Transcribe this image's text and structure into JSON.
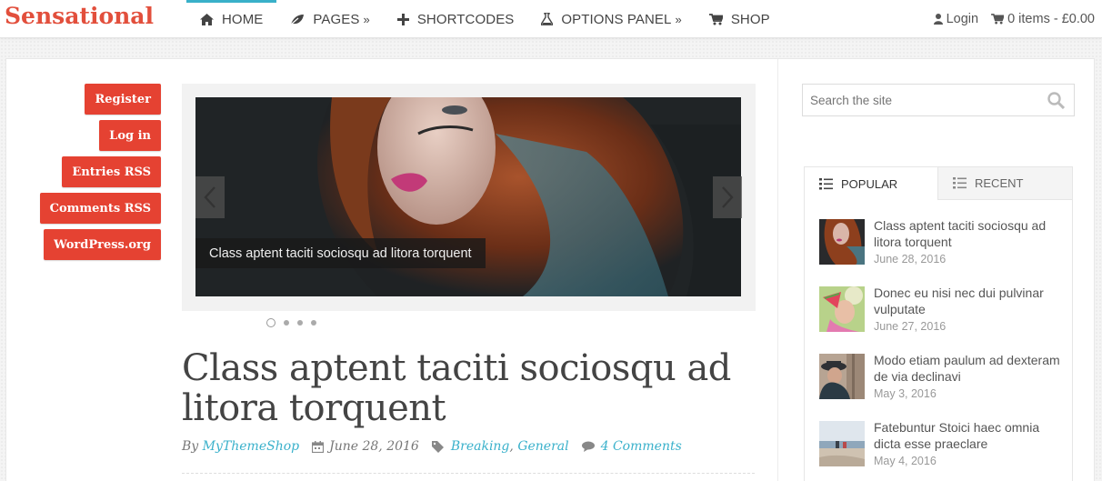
{
  "site": {
    "logo": "Sensational"
  },
  "nav": {
    "items": [
      {
        "label": "HOME",
        "icon": "home-icon",
        "active": true
      },
      {
        "label": "PAGES",
        "icon": "leaf-icon",
        "has_submenu": true
      },
      {
        "label": "SHORTCODES",
        "icon": "plus-icon"
      },
      {
        "label": "OPTIONS PANEL",
        "icon": "flask-icon",
        "has_submenu": true
      },
      {
        "label": "SHOP",
        "icon": "cart-icon"
      }
    ],
    "login": "Login",
    "cart": "0 items - £0.00"
  },
  "meta_widget": {
    "buttons": [
      "Register",
      "Log in",
      "Entries RSS",
      "Comments RSS",
      "WordPress.org"
    ]
  },
  "slider": {
    "caption": "Class aptent taciti sociosqu ad litora torquent",
    "slide_count": 4,
    "active_slide": 1
  },
  "post": {
    "title": "Class aptent taciti sociosqu ad litora torquent",
    "by_label": "By",
    "author": "MyThemeShop",
    "date": "June 28, 2016",
    "categories": [
      "Breaking",
      "General"
    ],
    "comments": "4 Comments"
  },
  "sidebar": {
    "search_placeholder": "Search the site",
    "tabs": [
      {
        "label": "POPULAR",
        "active": true
      },
      {
        "label": "RECENT",
        "active": false
      }
    ],
    "posts": [
      {
        "title": "Class aptent taciti sociosqu ad litora torquent",
        "date": "June 28, 2016"
      },
      {
        "title": "Donec eu nisi nec dui pulvinar vulputate",
        "date": "June 27, 2016"
      },
      {
        "title": "Modo etiam paulum ad dexteram de via declinavi",
        "date": "May 3, 2016"
      },
      {
        "title": "Fatebuntur Stoici haec omnia dicta esse praeclare",
        "date": "May 4, 2016"
      }
    ]
  },
  "colors": {
    "accent_red": "#e54232",
    "accent_teal": "#39b0c9",
    "logo_red": "#e24f3c"
  }
}
